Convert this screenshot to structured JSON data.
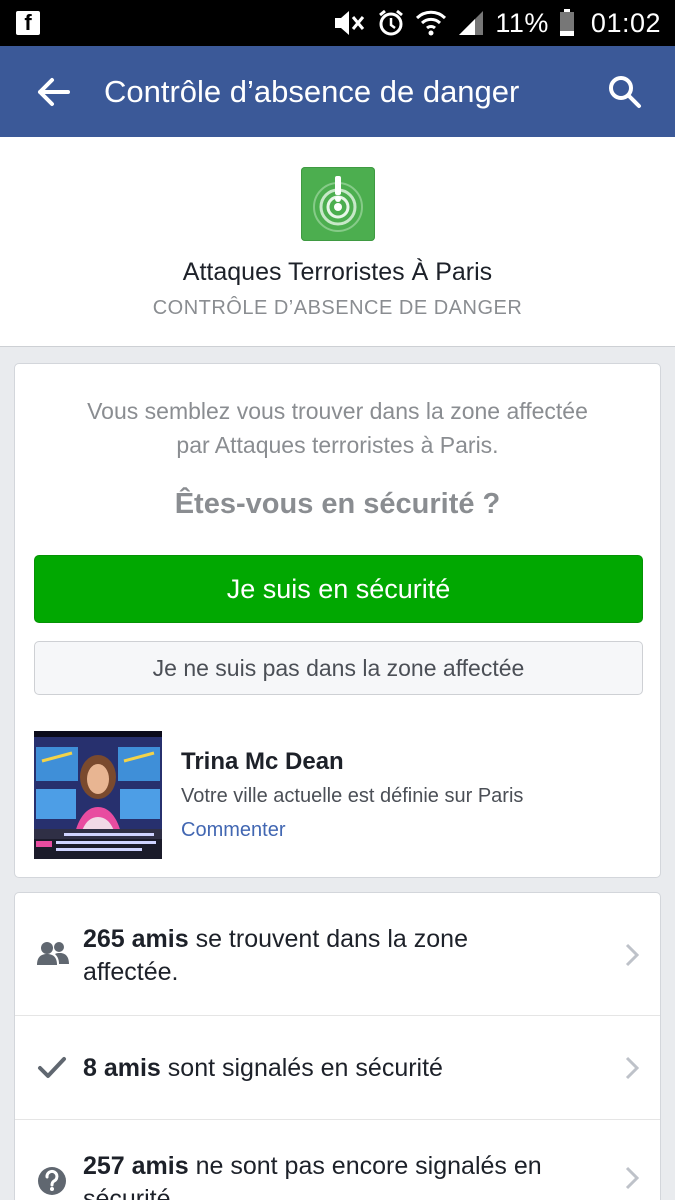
{
  "status_bar": {
    "battery_percent": "11%",
    "time": "01:02",
    "notification_app": "f"
  },
  "app_bar": {
    "title": "Contrôle d’absence de danger"
  },
  "header": {
    "event_title": "Attaques Terroristes À Paris",
    "subtitle": "CONTRÔLE D’ABSENCE DE DANGER"
  },
  "safety_card": {
    "message_line1": "Vous semblez vous trouver dans la zone affectée",
    "message_line2": "par Attaques terroristes à Paris.",
    "question": "Êtes-vous en sécurité ?",
    "safe_button_label": "Je suis en sécurité",
    "not_in_area_button_label": "Je ne suis pas dans la zone affectée",
    "post": {
      "name": "Trina Mc Dean",
      "text": "Votre ville actuelle est définie sur Paris",
      "comment_label": "Commenter"
    }
  },
  "friends_card": {
    "rows": [
      {
        "count": "265 amis",
        "text_line1": " se trouvent dans la zone",
        "text_line2": "affectée.",
        "icon": "friends-icon"
      },
      {
        "count": "8 amis",
        "text_line1": " sont signalés en sécurité",
        "icon": "checkmark-icon"
      },
      {
        "count": "257 amis",
        "text_line1": " ne sont pas encore signalés en",
        "text_line2": "sécurité.",
        "icon": "question-icon"
      }
    ]
  },
  "colors": {
    "brand_blue": "#3b5998",
    "safe_green": "#01a801",
    "safety_icon_green": "#4cae4f",
    "link_blue": "#4267b2"
  }
}
